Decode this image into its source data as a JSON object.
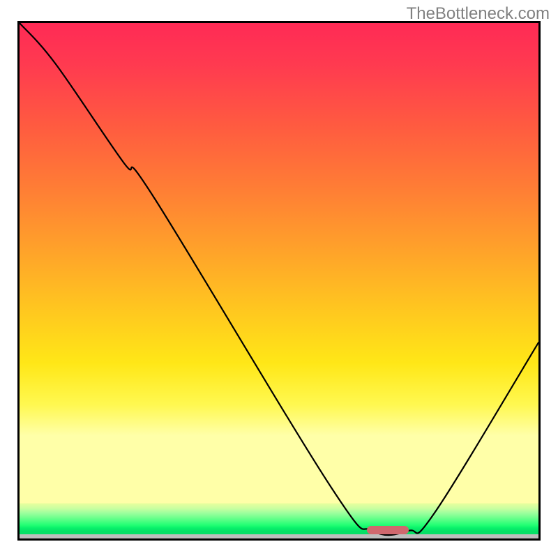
{
  "watermark": "TheBottleneck.com",
  "chart_data": {
    "type": "line",
    "title": "",
    "xlabel": "",
    "ylabel": "",
    "xlim": [
      0,
      100
    ],
    "ylim": [
      0,
      100
    ],
    "grid": false,
    "legend": false,
    "series": [
      {
        "name": "bottleneck-curve",
        "x": [
          0,
          7,
          20,
          26,
          60,
          68,
          75,
          80,
          100
        ],
        "y": [
          100,
          92,
          73,
          66,
          10,
          1.5,
          1.5,
          5,
          38
        ]
      }
    ],
    "optimum_band": {
      "x_start": 67,
      "x_end": 75,
      "y": 1.2
    },
    "annotations": []
  },
  "marker": {
    "left_pct": 67,
    "width_pct": 8,
    "bottom_pct": 0.8
  }
}
